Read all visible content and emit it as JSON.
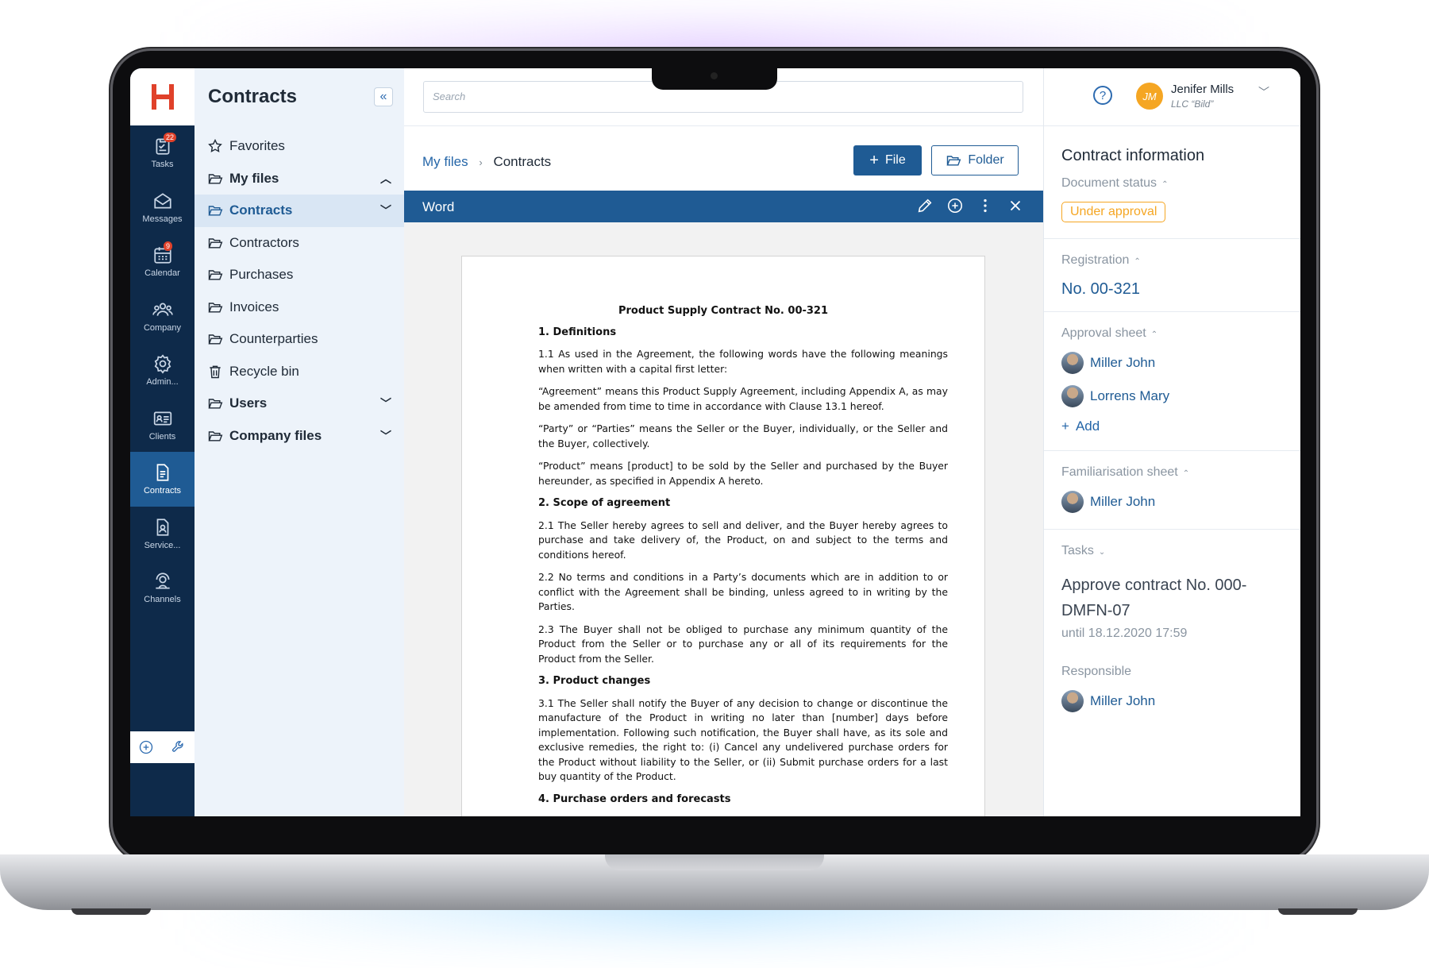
{
  "colors": {
    "brand": "#1f5b94",
    "rail": "#0e2a4a",
    "status": "#f5a623"
  },
  "rail": {
    "items": [
      {
        "label": "Tasks",
        "icon": "tasks-icon",
        "badge": "22"
      },
      {
        "label": "Messages",
        "icon": "messages-icon"
      },
      {
        "label": "Calendar",
        "icon": "calendar-icon",
        "badge": "9"
      },
      {
        "label": "Company",
        "icon": "company-icon"
      },
      {
        "label": "Admin...",
        "icon": "gear-icon"
      },
      {
        "label": "Clients",
        "icon": "clients-icon"
      },
      {
        "label": "Contracts",
        "icon": "document-icon"
      },
      {
        "label": "Service...",
        "icon": "service-icon"
      },
      {
        "label": "Channels",
        "icon": "channels-icon"
      }
    ]
  },
  "sidebar": {
    "title": "Contracts",
    "collapse_label": "«",
    "items": [
      {
        "label": "Favorites"
      },
      {
        "label": "My files"
      },
      {
        "label": "Contracts"
      },
      {
        "label": "Contractors"
      },
      {
        "label": "Purchases"
      },
      {
        "label": "Invoices"
      },
      {
        "label": "Counterparties"
      },
      {
        "label": "Recycle bin"
      },
      {
        "label": "Users"
      },
      {
        "label": "Company files"
      }
    ]
  },
  "search": {
    "placeholder": "Search"
  },
  "breadcrumb": {
    "root": "My files",
    "separator": "›",
    "current": "Contracts"
  },
  "toolbar": {
    "file_label": "File",
    "folder_label": "Folder"
  },
  "viewer": {
    "name": "Word"
  },
  "document": {
    "title": "Product Supply Contract No. 00-321",
    "s1": "1. Definitions",
    "p1": "1.1 As used in the Agreement, the following words have the following meanings when written with a capital first letter:",
    "p2": "“Agreement” means this Product Supply Agreement, including Appendix A, as may be amended from time to time in accordance with Clause 13.1 hereof.",
    "p3": "“Party” or “Parties” means the Seller or the Buyer, individually, or the Seller and the Buyer, collectively.",
    "p4": "“Product” means [product] to be sold by the Seller and purchased by the Buyer hereunder, as specified in Appendix A hereto.",
    "s2": "2. Scope of agreement",
    "p5": "2.1 The Seller hereby agrees to sell and deliver, and the Buyer hereby agrees to purchase and take delivery of, the Product, on and subject to the terms and conditions hereof.",
    "p6": "2.2 No terms and conditions in a Party’s documents which are in addition to or conflict with the Agreement shall be binding, unless agreed to in writing by the Parties.",
    "p7": "2.3 The Buyer shall not be obliged to purchase any minimum quantity of the Product from the Seller or to purchase any or all of its requirements for the Product from the Seller.",
    "s3": "3. Product changes",
    "p8": "3.1 The Seller shall notify the Buyer of any decision to change or discontinue the manufacture of the Product in writing no later than [number] days before implementation. Following such notification, the Buyer shall have, as its sole and exclusive remedies, the right to: (i) Cancel any undelivered purchase orders for the Product without liability to the Seller, or (ii) Submit purchase orders for a last buy quantity of the Product.",
    "s4": "4. Purchase orders and forecasts"
  },
  "user": {
    "initials": "JM",
    "name": "Jenifer Mills",
    "org": "LLC “Bild”"
  },
  "info": {
    "title": "Contract information",
    "status_label": "Document status",
    "status_value": "Under approval",
    "registration_label": "Registration",
    "registration_value": "No. 00-321",
    "approval_label": "Approval sheet",
    "approvers": [
      "Miller John",
      "Lorrens Mary"
    ],
    "add_label": "Add",
    "familiarisation_label": "Familiarisation sheet",
    "familiarisation": [
      "Miller John"
    ],
    "tasks_label": "Tasks",
    "task_title": "Approve contract No. 000-DMFN-07",
    "task_due": "until 18.12.2020 17:59",
    "responsible_label": "Responsible",
    "responsible": "Miller John"
  }
}
